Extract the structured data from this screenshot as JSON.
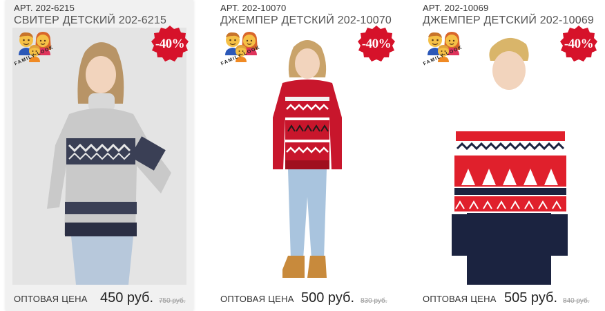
{
  "products": [
    {
      "article": "АРТ. 202-6215",
      "name": "СВИТЕР ДЕТСКИЙ 202-6215",
      "discount": "-40%",
      "family_look": "FAMILY LOOK",
      "price_label": "ОПТОВАЯ ЦЕНА",
      "price": "450 руб.",
      "old_price": "750 руб."
    },
    {
      "article": "АРТ. 202-10070",
      "name": "ДЖЕМПЕР ДЕТСКИЙ 202-10070",
      "discount": "-40%",
      "family_look": "FAMILY LOOK",
      "price_label": "ОПТОВАЯ ЦЕНА",
      "price": "500 руб.",
      "old_price": "830 руб."
    },
    {
      "article": "АРТ. 202-10069",
      "name": "ДЖЕМПЕР ДЕТСКИЙ 202-10069",
      "discount": "-40%",
      "family_look": "FAMILY LOOK",
      "price_label": "ОПТОВАЯ ЦЕНА",
      "price": "505 руб.",
      "old_price": "840 руб."
    }
  ],
  "colors": {
    "badge": "#d6122a",
    "card_hover_bg": "#f1f1f1",
    "old_price": "#999999"
  },
  "icons": [
    "family-look-icon",
    "discount-badge-icon"
  ]
}
